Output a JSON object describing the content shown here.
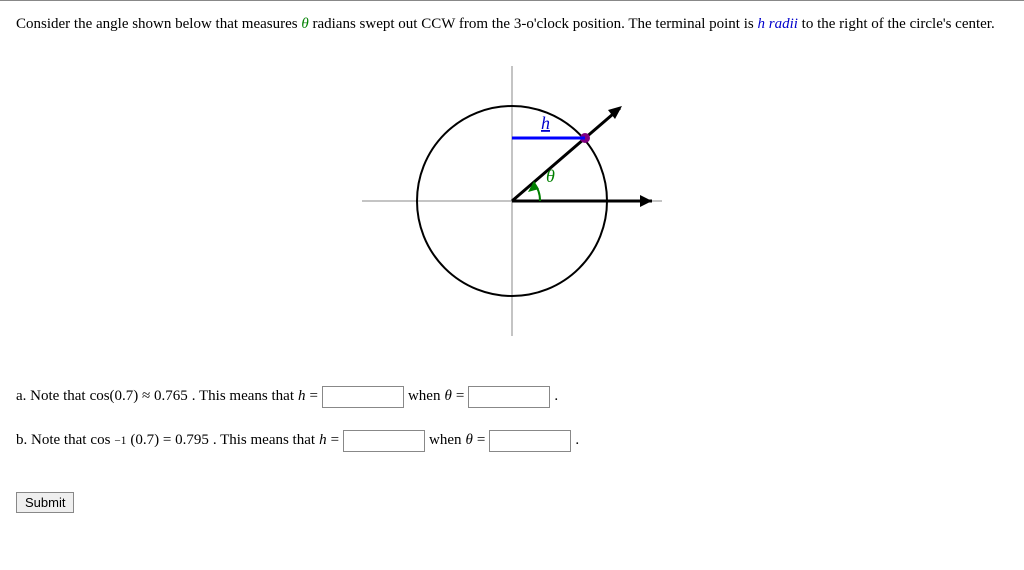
{
  "intro": {
    "part1": "Consider the angle shown below that measures ",
    "theta": "θ",
    "part2": " radians swept out CCW from the 3-o'clock position. The terminal point is ",
    "h_radii_text": "h radii",
    "part3": " to the right of the circle's center."
  },
  "diagram": {
    "h_label": "h",
    "theta_label": "θ"
  },
  "questions": {
    "a": {
      "prefix": "a. Note that ",
      "expr_prefix": "cos(0.7) ≈ 0.765",
      "means": ". This means that ",
      "var": "h",
      "eq": " = ",
      "when": " when ",
      "theta": "θ",
      "eq2": " = ",
      "period": "."
    },
    "b": {
      "prefix": "b. Note that ",
      "cos": "cos",
      "sup": "−1",
      "arg": "(0.7) = 0.795",
      "means": ". This means that ",
      "var": "h",
      "eq": " = ",
      "when": " when ",
      "theta": "θ",
      "eq2": " = ",
      "period": "."
    }
  },
  "submit_label": "Submit"
}
